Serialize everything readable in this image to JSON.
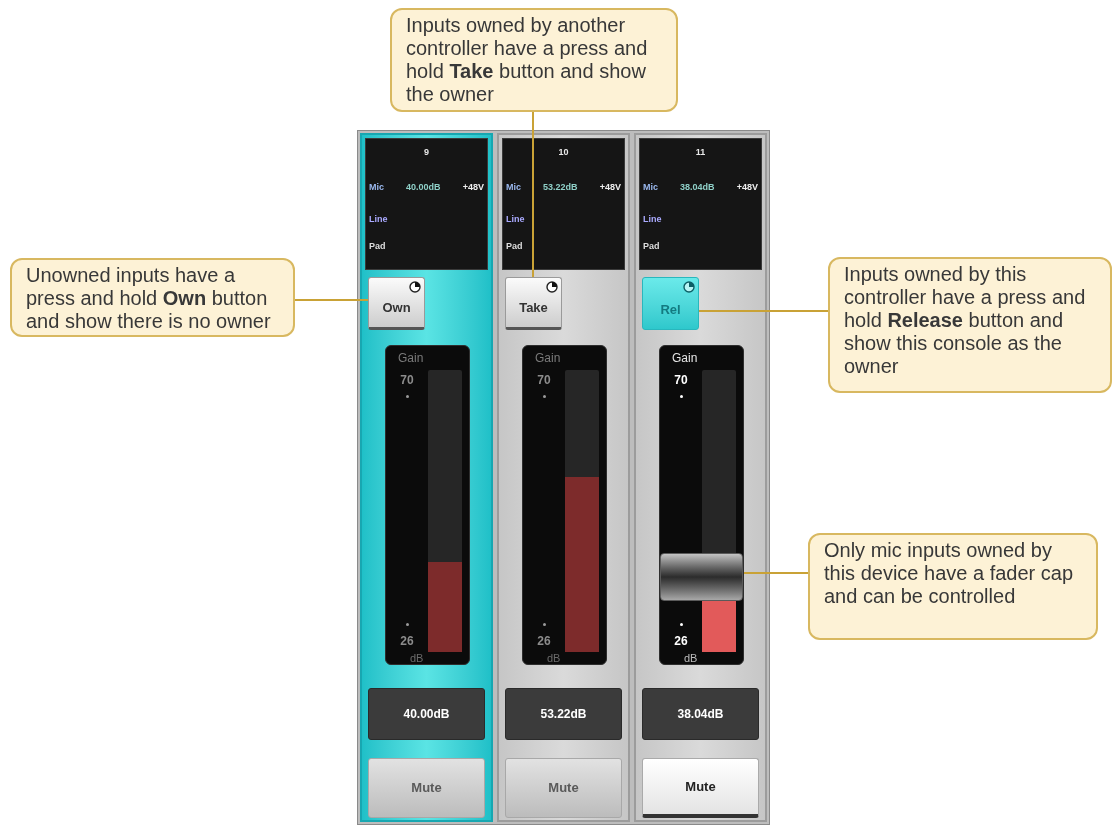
{
  "callouts": [
    "Inputs owned by another controller have a press and hold **Take** button and show the owner",
    "Unowned inputs have a press and hold **Own** button and show there is no owner",
    "Inputs owned by this controller have a press and hold **Release** button and show this console as the owner",
    "Only mic inputs owned by this device have a fader cap and can be controlled"
  ],
  "channels": [
    {
      "number": "9",
      "selected": true,
      "mic": {
        "label": "Mic",
        "gain": "40.00dB",
        "phantom": "+48V"
      },
      "line": "Line",
      "pad": "Pad",
      "owner_button": {
        "label": "Own",
        "on": false
      },
      "fader": {
        "title": "Gain",
        "max": "70",
        "min": "26",
        "unit": "dB",
        "level": 0.32,
        "enabled": false,
        "cap": false
      },
      "readout": "40.00dB",
      "mute": {
        "label": "Mute",
        "disabled": true
      }
    },
    {
      "number": "10",
      "selected": false,
      "mic": {
        "label": "Mic",
        "gain": "53.22dB",
        "phantom": "+48V"
      },
      "line": "Line",
      "pad": "Pad",
      "owner_button": {
        "label": "Take",
        "on": false
      },
      "fader": {
        "title": "Gain",
        "max": "70",
        "min": "26",
        "unit": "dB",
        "level": 0.62,
        "enabled": false,
        "cap": false
      },
      "readout": "53.22dB",
      "mute": {
        "label": "Mute",
        "disabled": true
      }
    },
    {
      "number": "11",
      "selected": false,
      "mic": {
        "label": "Mic",
        "gain": "38.04dB",
        "phantom": "+48V"
      },
      "line": "Line",
      "pad": "Pad",
      "owner_button": {
        "label": "Rel",
        "on": true
      },
      "fader": {
        "title": "Gain",
        "max": "70",
        "min": "26",
        "unit": "dB",
        "level": 0.27,
        "enabled": true,
        "cap": true
      },
      "readout": "38.04dB",
      "mute": {
        "label": "Mute",
        "disabled": false
      }
    }
  ]
}
